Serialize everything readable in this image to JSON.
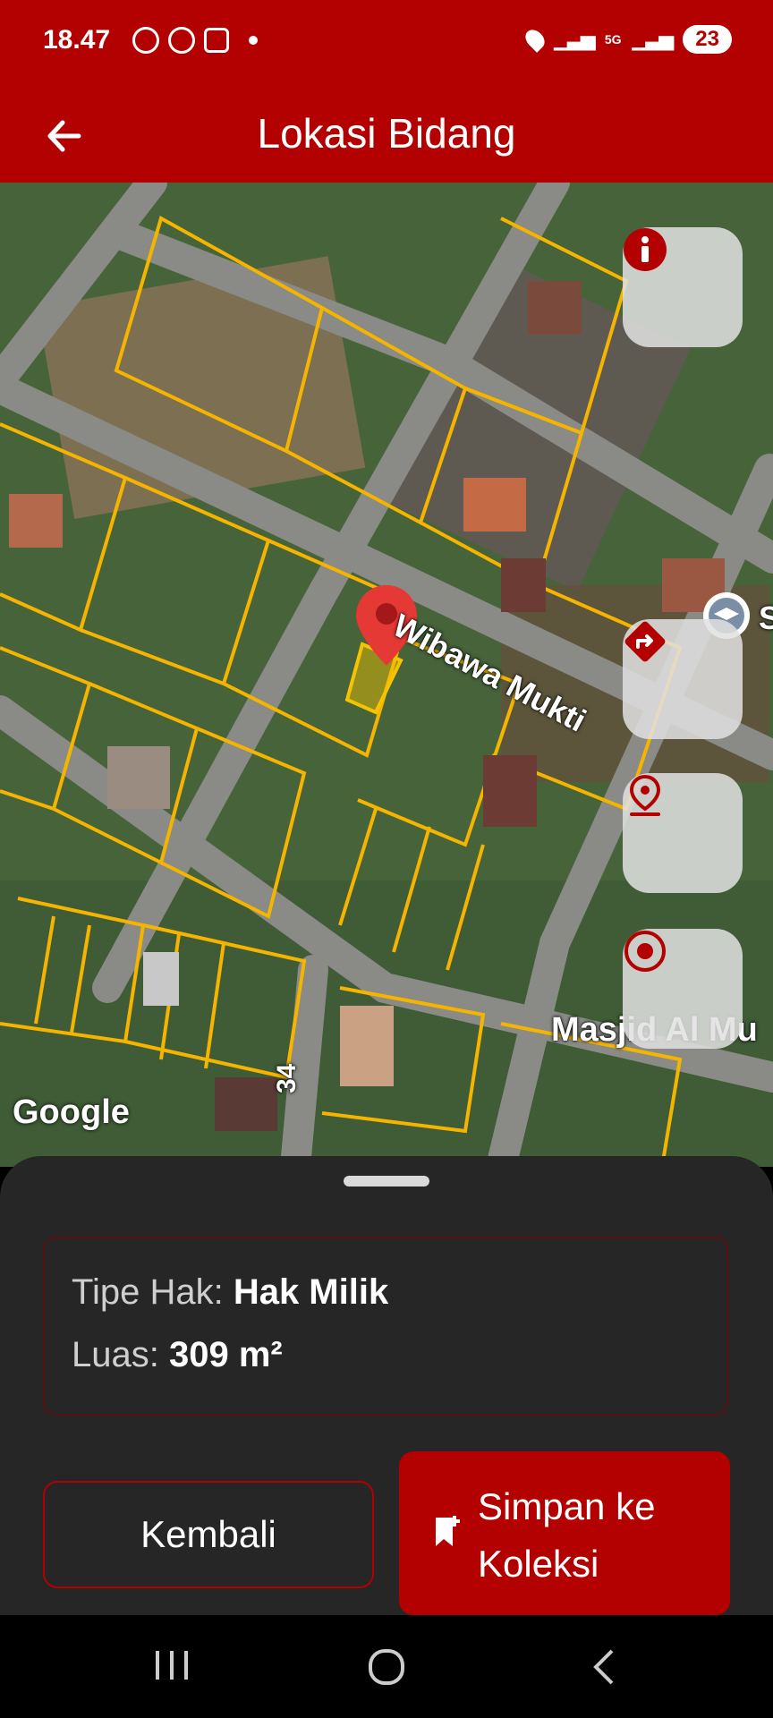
{
  "status_bar": {
    "time": "18.47",
    "network": "5G",
    "battery": "23",
    "icons": [
      "whatsapp-business-icon",
      "whatsapp-icon",
      "screenshot-icon",
      "dot-icon",
      "location-icon",
      "signal-icon",
      "signal-icon",
      "battery-icon"
    ]
  },
  "app_bar": {
    "title": "Lokasi Bidang",
    "back_icon": "arrow-left-icon"
  },
  "map": {
    "labels": {
      "road": "Wibawa Mukti",
      "poi": "Masjid Al Mu",
      "poi_partial": "S",
      "road_number": "34"
    },
    "attribution": "Google",
    "map_buttons": [
      "info-icon",
      "directions-icon",
      "location-pin-icon",
      "target-icon"
    ],
    "highlight_color": "#f5c400"
  },
  "parcel_info": {
    "rights_type_label": "Tipe Hak:",
    "rights_type_value": "Hak Milik",
    "area_label": "Luas:",
    "area_value": "309 m²"
  },
  "actions": {
    "back_label": "Kembali",
    "save_label": "Simpan ke Koleksi"
  },
  "colors": {
    "primary": "#b30000",
    "sheet_background": "#262626",
    "parcel_lines": "#f5b400"
  }
}
